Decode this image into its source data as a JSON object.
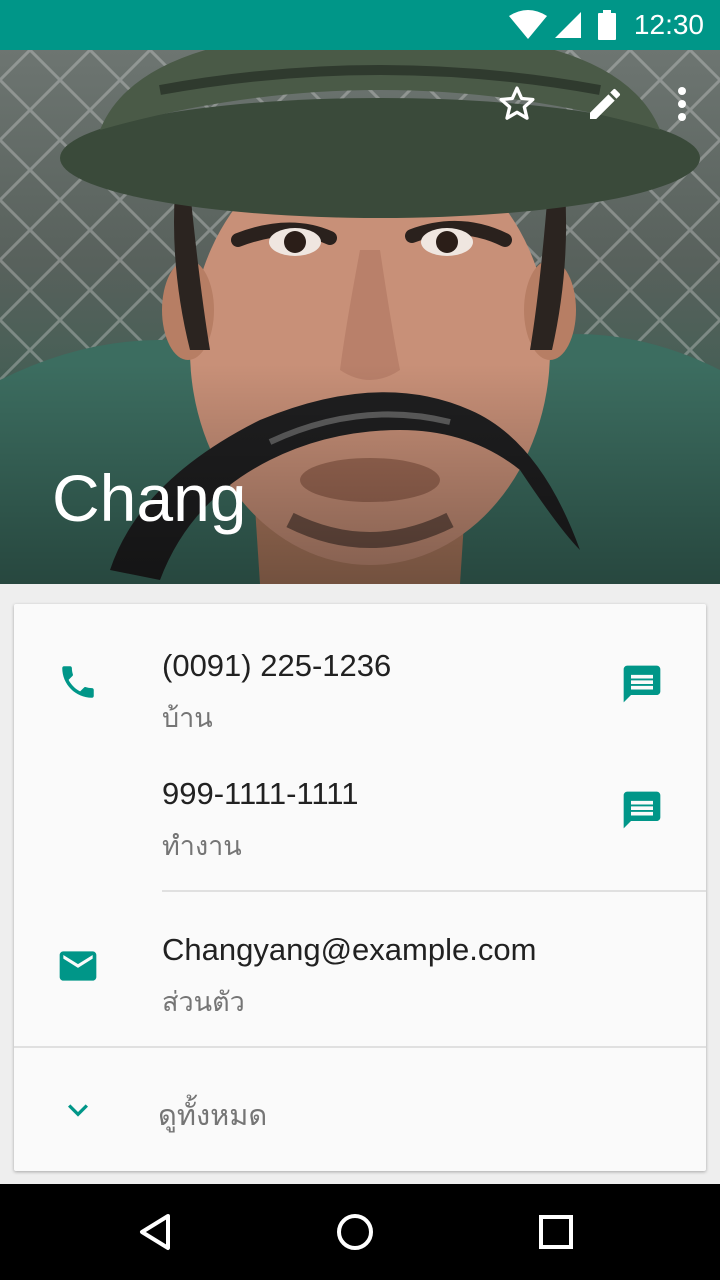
{
  "status_bar": {
    "time": "12:30",
    "icons": [
      "wifi-icon",
      "cell-signal-icon",
      "battery-icon"
    ],
    "bg_color": "#009688"
  },
  "header": {
    "contact_name": "Chang",
    "actions": [
      "star-icon",
      "edit-icon",
      "more-vert-icon"
    ]
  },
  "phones": [
    {
      "number": "(0091) 225-1236",
      "label": "บ้าน"
    },
    {
      "number": "999-1111-1111",
      "label": "ทำงาน"
    }
  ],
  "email": {
    "address": "Changyang@example.com",
    "label": "ส่วนตัว"
  },
  "see_all": {
    "label": "ดูทั้งหมด"
  },
  "accent_color": "#009688",
  "nav_bar": {
    "buttons": [
      "back-icon",
      "home-icon",
      "recents-icon"
    ]
  }
}
